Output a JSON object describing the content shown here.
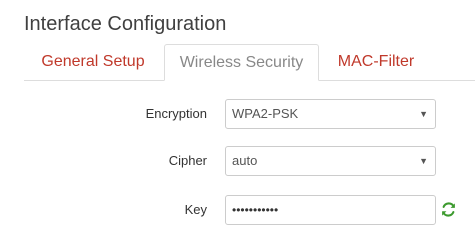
{
  "page": {
    "title": "Interface Configuration"
  },
  "tabs": [
    {
      "label": "General Setup",
      "active": false
    },
    {
      "label": "Wireless Security",
      "active": true
    },
    {
      "label": "MAC-Filter",
      "active": false
    }
  ],
  "form": {
    "encryption": {
      "label": "Encryption",
      "value": "WPA2-PSK"
    },
    "cipher": {
      "label": "Cipher",
      "value": "auto"
    },
    "key": {
      "label": "Key",
      "value": "•••••••••••"
    }
  },
  "icons": {
    "select_caret": "chevron-down-icon",
    "key_action": "refresh-icon"
  },
  "colors": {
    "tab_link": "#c0392b",
    "tab_active": "#888888",
    "refresh_icon": "#3c9a2e"
  }
}
